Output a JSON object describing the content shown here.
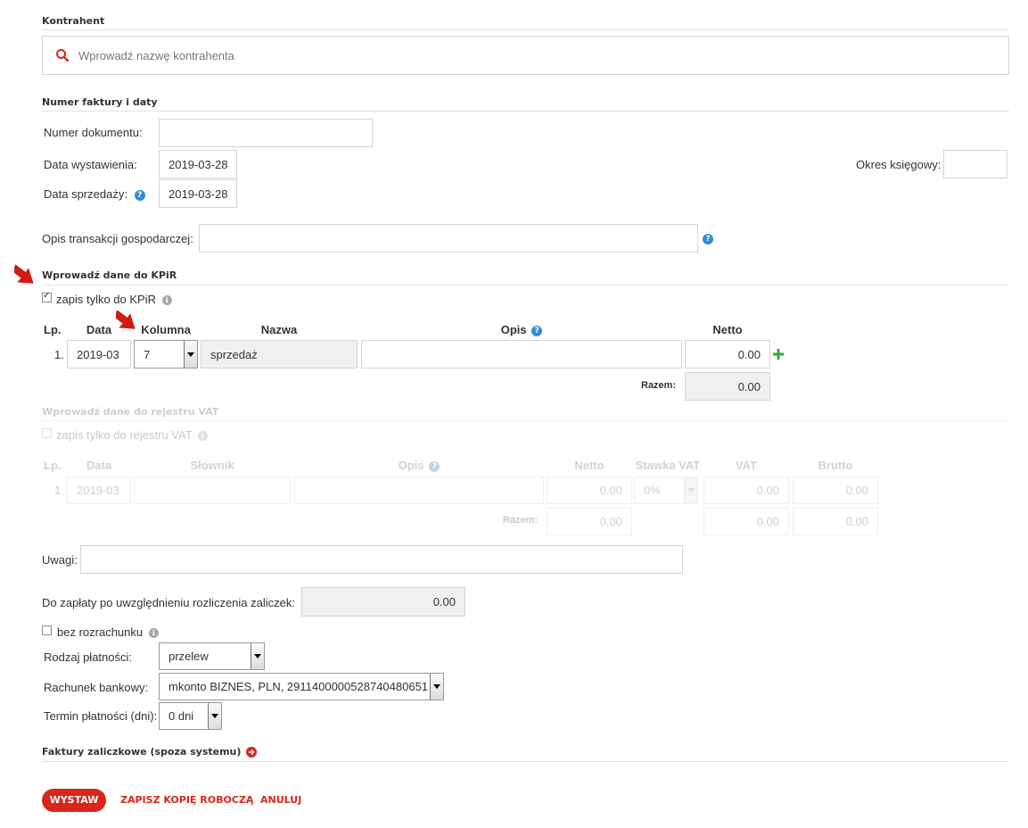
{
  "contractor": {
    "section_title": "Kontrahent",
    "search_placeholder": "Wprowadź nazwę kontrahenta"
  },
  "invoice": {
    "section_title": "Numer faktury i daty",
    "doc_number_label": "Numer dokumentu:",
    "doc_number_value": "",
    "issue_date_label": "Data wystawienia:",
    "issue_date_value": "2019-03-28",
    "sale_date_label": "Data sprzedaży:",
    "sale_date_value": "2019-03-28",
    "period_label": "Okres księgowy:",
    "period_value": "",
    "transaction_label": "Opis transakcji gospodarczej:",
    "transaction_value": ""
  },
  "kpir": {
    "section_title": "Wprowadź dane do KPiR",
    "only_kpir_label": "zapis tylko do KPiR",
    "only_kpir_checked": true,
    "headers": {
      "lp": "Lp.",
      "date": "Data",
      "column": "Kolumna",
      "name": "Nazwa",
      "desc": "Opis",
      "net": "Netto"
    },
    "rows": [
      {
        "lp": "1.",
        "date": "2019-03",
        "column": "7",
        "name": "sprzedaż",
        "desc": "",
        "net": "0.00"
      }
    ],
    "total_label": "Razem:",
    "total_value": "0.00"
  },
  "vat": {
    "section_title": "Wprowadź dane do rejestru VAT",
    "only_vat_label": "zapis tylko do rejestru VAT",
    "headers": {
      "lp": "Lp.",
      "date": "Data",
      "dict": "Słownik",
      "desc": "Opis",
      "net": "Netto",
      "rate": "Stawka VAT",
      "vat": "VAT",
      "gross": "Brutto"
    },
    "rows": [
      {
        "lp": "1.",
        "date": "2019-03",
        "dict": "",
        "desc": "",
        "net": "0.00",
        "rate": "0%",
        "vat": "0.00",
        "gross": "0.00"
      }
    ],
    "total_label": "Razem:",
    "total_net": "0.00",
    "total_vat": "0.00",
    "total_gross": "0.00"
  },
  "notes": {
    "label": "Uwagi:",
    "value": ""
  },
  "payment": {
    "to_pay_label": "Do zapłaty po uwzględnieniu rozliczenia zaliczek:",
    "to_pay_value": "0.00",
    "no_settlement_label": "bez rozrachunku",
    "method_label": "Rodzaj płatności:",
    "method_value": "przelew",
    "account_label": "Rachunek bankowy:",
    "account_value": "mkonto BIZNES, PLN, 2911400000528740480651",
    "term_label": "Termin płatności (dni):",
    "term_value": "0 dni"
  },
  "advance": {
    "section_title": "Faktury zaliczkowe (spoza systemu)"
  },
  "actions": {
    "issue": "WYSTAW",
    "save_draft": "ZAPISZ KOPIĘ ROBOCZĄ",
    "cancel": "ANULUJ"
  },
  "colors": {
    "accent": "#d9261c",
    "help": "#2e8fd6",
    "add": "#3aaa35"
  }
}
